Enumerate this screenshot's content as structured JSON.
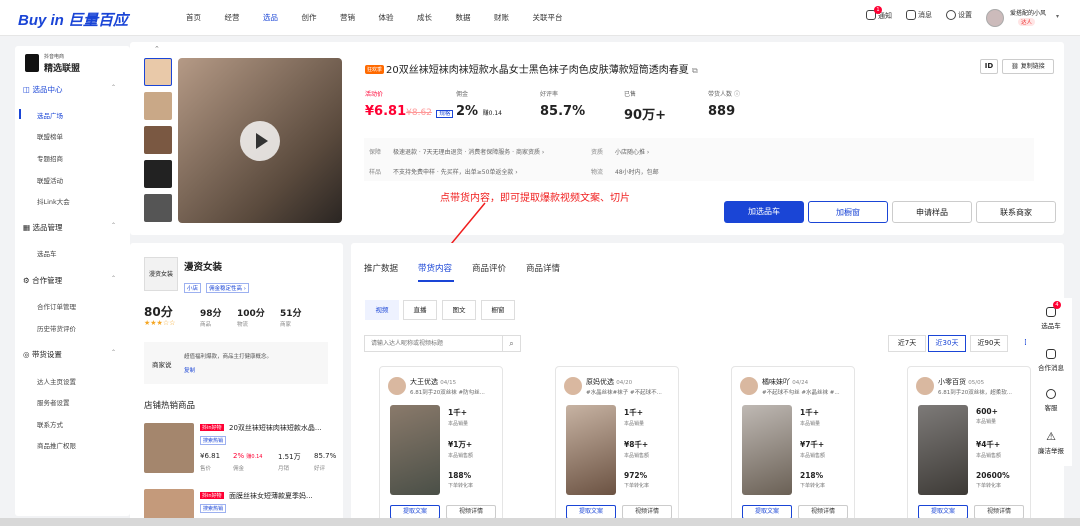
{
  "header": {
    "logo_text": "Buy in 巨量百应",
    "nav": [
      "首页",
      "经营",
      "选品",
      "创作",
      "营销",
      "体验",
      "成长",
      "数据",
      "财账",
      "关联平台"
    ],
    "notify_label": "通知",
    "notify_count": "1",
    "message_label": "消息",
    "settings_label": "设置",
    "user_name": "爱搭配的小风",
    "user_role": "达人"
  },
  "sidebar": {
    "brand_top": "抖音电商",
    "brand_main": "精选联盟",
    "groups": [
      {
        "label": "选品中心",
        "items": [
          "选品广场",
          "联盟榜单",
          "专题招商",
          "联盟活动",
          "抖Link大会"
        ]
      },
      {
        "label": "选品管理",
        "items": [
          "选品车"
        ]
      },
      {
        "label": "合作管理",
        "items": [
          "合作订单管理",
          "历史带货评价"
        ]
      },
      {
        "label": "带货设置",
        "items": [
          "达人主页设置",
          "服务者设置",
          "联系方式",
          "商品推广权限"
        ]
      }
    ]
  },
  "product": {
    "badge": "狂欢季",
    "title": "20双丝袜短袜肉袜短款水晶女士黑色袜子肉色皮肤薄款短筒透肉春夏",
    "id_label": "ID",
    "copy_link": "复制链接",
    "stats": [
      {
        "label": "活动价",
        "value": "¥6.81",
        "extra": "¥8.62"
      },
      {
        "label": "佣金",
        "value": "2%",
        "extra": "赚0.14"
      },
      {
        "label": "好评率",
        "value": "85.7%"
      },
      {
        "label": "已售",
        "value": "90万+"
      },
      {
        "label": "带货人数",
        "value": "889"
      }
    ],
    "services": {
      "guarantee_label": "保障",
      "guarantee": "极速退款 · 7天无理由退货 · 消费者保障服务 · 商家资质 ›",
      "qual_label": "资质",
      "qual": "小店随心推 ›",
      "sample_label": "样品",
      "sample": "不支持免费申样 · 先买样，出单≥50单返全款 ›",
      "logistics_label": "物流",
      "logistics": "48小时内，包邮"
    },
    "buttons": [
      "加选品车",
      "加橱窗",
      "申请样品",
      "联系商家"
    ]
  },
  "annotation": "点带货内容，即可提取爆款视频文案、切片",
  "shop": {
    "logo_text": "漫资女装",
    "name": "漫资女装",
    "tags": [
      "小店",
      "佣金稳定性高 ›"
    ],
    "scores": [
      {
        "value": "80分",
        "label": ""
      },
      {
        "value": "98分",
        "label": "商品"
      },
      {
        "value": "100分",
        "label": "物流"
      },
      {
        "value": "51分",
        "label": "商家"
      }
    ],
    "desc_label": "商家说",
    "desc": "超值福利爆款，商品主打健康概念。",
    "copy": "复制",
    "hot_title": "店铺热销商品",
    "hot": [
      {
        "tag": "抖in好物",
        "tag2": "搜索热销",
        "title": "20双丝袜短袜肉袜短款水晶...",
        "price": "¥6.81",
        "price_l": "售价",
        "comm": "2%",
        "comm2": "赚0.14",
        "comm_l": "佣金",
        "sales": "1.51万",
        "sales_l": "月销",
        "rate": "85.7%",
        "rate_l": "好评"
      },
      {
        "tag": "抖in好物",
        "tag2": "搜索热销",
        "title": "面膜丝袜女短薄款夏季妈..."
      }
    ]
  },
  "tabs": [
    "推广数据",
    "带货内容",
    "商品评价",
    "商品详情"
  ],
  "subtabs": [
    "视频",
    "直播",
    "图文",
    "橱窗"
  ],
  "search_placeholder": "请输入达人昵称或视频标题",
  "ranges": [
    "近7天",
    "近30天",
    "近90天"
  ],
  "videos": [
    {
      "name": "大王优选",
      "date": "04/15",
      "desc": "6.81到手20双丝袜 #防勾丝...",
      "m1": "1千+",
      "m1l": "本品销量",
      "m2": "¥1万+",
      "m2l": "本品销售额",
      "m3": "188%",
      "m3l": "下单转化率",
      "b1": "提取文案",
      "b2": "视频详情"
    },
    {
      "name": "原妈优选",
      "date": "04/20",
      "desc": "#水晶丝袜#袜子 #不起球不...",
      "m1": "1千+",
      "m1l": "本品销量",
      "m2": "¥8千+",
      "m2l": "本品销售额",
      "m3": "972%",
      "m3l": "下单转化率",
      "b1": "提取文案",
      "b2": "视频详情"
    },
    {
      "name": "橘味妹吖",
      "date": "04/24",
      "desc": "#不起球不勾丝 #水晶丝袜 #...",
      "m1": "1千+",
      "m1l": "本品销量",
      "m2": "¥7千+",
      "m2l": "本品销售额",
      "m3": "218%",
      "m3l": "下单转化率",
      "b1": "提取文案",
      "b2": "视频详情"
    },
    {
      "name": "小零百货",
      "date": "05/05",
      "desc": "6.81到手20双丝袜，超柔软...",
      "m1": "600+",
      "m1l": "本品销量",
      "m2": "¥4千+",
      "m2l": "本品销售额",
      "m3": "20600%",
      "m3l": "下单转化率",
      "b1": "提取文案",
      "b2": "视频详情"
    }
  ],
  "rail": [
    {
      "label": "选品车",
      "count": "4"
    },
    {
      "label": "合作消息"
    },
    {
      "label": "客服"
    },
    {
      "label": "廉洁举报"
    }
  ]
}
